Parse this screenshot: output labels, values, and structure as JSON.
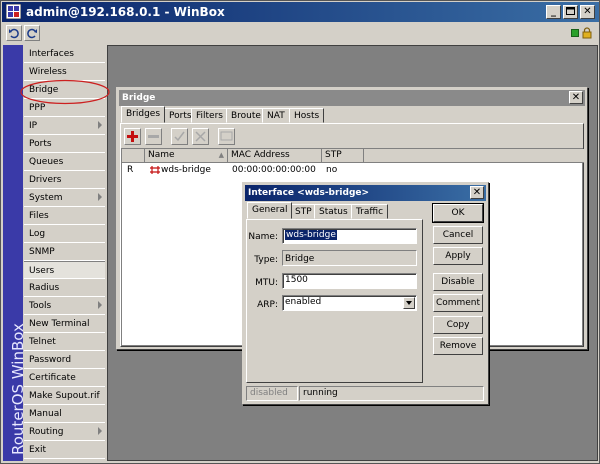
{
  "window": {
    "title": "admin@192.168.0.1 - WinBox",
    "min_label": "_",
    "max_label": "□",
    "close_label": "✕"
  },
  "brand": {
    "vertical_text": "RouterOS WinBox"
  },
  "colors": {
    "title_gradient_start": "#0a246a",
    "title_gradient_end": "#3a6ea5",
    "brand_bar": "#3a3aa8",
    "highlight_circle": "#cc2020",
    "status_green": "#2aa02a",
    "status_lock": "#e0b020"
  },
  "toolbar": {
    "icons": [
      "undo-icon",
      "redo-icon"
    ]
  },
  "sidebar": {
    "items": [
      {
        "label": "Interfaces",
        "has_submenu": false
      },
      {
        "label": "Wireless",
        "has_submenu": false
      },
      {
        "label": "Bridge",
        "has_submenu": false,
        "highlighted": true
      },
      {
        "label": "PPP",
        "has_submenu": false
      },
      {
        "label": "IP",
        "has_submenu": true
      },
      {
        "label": "Ports",
        "has_submenu": false
      },
      {
        "label": "Queues",
        "has_submenu": false
      },
      {
        "label": "Drivers",
        "has_submenu": false
      },
      {
        "label": "System",
        "has_submenu": true
      },
      {
        "label": "Files",
        "has_submenu": false
      },
      {
        "label": "Log",
        "has_submenu": false
      },
      {
        "label": "SNMP",
        "has_submenu": false
      },
      {
        "label": "Users",
        "has_submenu": false,
        "active": true
      },
      {
        "label": "Radius",
        "has_submenu": false
      },
      {
        "label": "Tools",
        "has_submenu": true
      },
      {
        "label": "New Terminal",
        "has_submenu": false
      },
      {
        "label": "Telnet",
        "has_submenu": false
      },
      {
        "label": "Password",
        "has_submenu": false
      },
      {
        "label": "Certificate",
        "has_submenu": false
      },
      {
        "label": "Make Supout.rif",
        "has_submenu": false
      },
      {
        "label": "Manual",
        "has_submenu": false
      },
      {
        "label": "Routing",
        "has_submenu": true
      },
      {
        "label": "Exit",
        "has_submenu": false
      }
    ]
  },
  "bridge_window": {
    "title": "Bridge",
    "close_label": "✕",
    "tabs": [
      "Bridges",
      "Ports",
      "Filters",
      "Broute",
      "NAT",
      "Hosts"
    ],
    "active_tab": "Bridges",
    "columns": [
      "",
      "Name",
      "MAC Address",
      "STP"
    ],
    "sort_indicator": "▲",
    "rows": [
      {
        "flag": "R",
        "name": "wds-bridge",
        "mac": "00:00:00:00:00:00",
        "stp": "no"
      }
    ]
  },
  "dialog": {
    "title": "Interface <wds-bridge>",
    "close_label": "✕",
    "tabs": [
      "General",
      "STP",
      "Status",
      "Traffic"
    ],
    "active_tab": "General",
    "fields": {
      "name_label": "Name:",
      "name_value": "wds-bridge",
      "type_label": "Type:",
      "type_value": "Bridge",
      "mtu_label": "MTU:",
      "mtu_value": "1500",
      "arp_label": "ARP:",
      "arp_value": "enabled"
    },
    "buttons": {
      "ok": "OK",
      "cancel": "Cancel",
      "apply": "Apply",
      "disable": "Disable",
      "comment": "Comment",
      "copy": "Copy",
      "remove": "Remove"
    },
    "status": {
      "left": "disabled",
      "right": "running"
    }
  }
}
